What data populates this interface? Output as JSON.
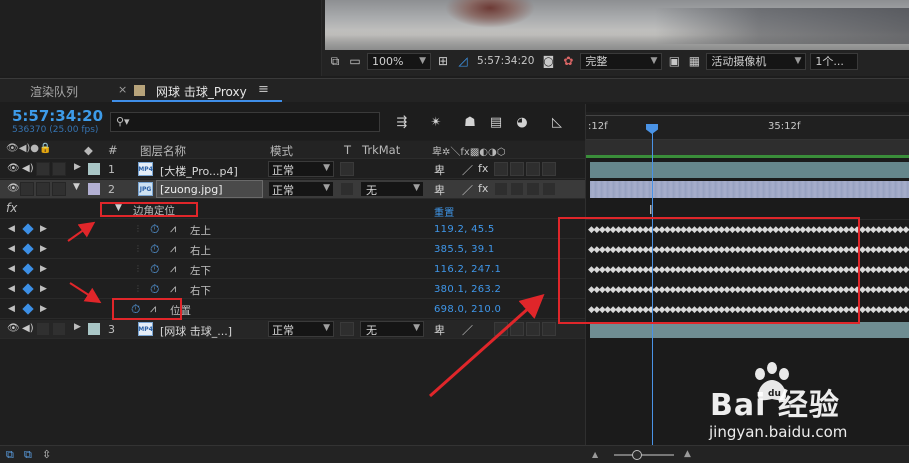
{
  "viewer_toolbar": {
    "zoom": "100%",
    "timecode": "5:57:34:20",
    "resolution": "完整",
    "camera": "活动摄像机",
    "views": "1个..."
  },
  "panel_tabs": {
    "render_queue": "渲染队列",
    "close_glyph": "×",
    "comp_name": "网球 击球_Proxy",
    "menu_glyph": "≡"
  },
  "timeline": {
    "current_time": "5:57:34:20",
    "frame_info": "536370 (25.00 fps)",
    "search_placeholder": "",
    "ruler_labels": [
      ":12f",
      "35:12f"
    ]
  },
  "columns": {
    "number": "#",
    "layer_name": "图层名称",
    "mode": "模式",
    "t": "T",
    "trkmat": "TrkMat"
  },
  "layers": [
    {
      "number": "1",
      "name": "[大楼_Pro...p4]",
      "mode": "正常",
      "trkmat": "",
      "label_color": "#a9c6c6",
      "file_type": "MP4"
    },
    {
      "number": "2",
      "name": "[zuong.jpg]",
      "mode": "正常",
      "trkmat": "无",
      "label_color": "#b3b0d3",
      "file_type": "JPG"
    },
    {
      "number": "3",
      "name": "[网球 击球_...]",
      "mode": "正常",
      "trkmat": "无",
      "label_color": "#a9c6c6",
      "file_type": "MP4"
    }
  ],
  "effect": {
    "fx_glyph": "fx",
    "name": "边角定位",
    "reset": "重置"
  },
  "properties": [
    {
      "name": "左上",
      "value": "119.2, 45.5"
    },
    {
      "name": "右上",
      "value": "385.5, 39.1"
    },
    {
      "name": "左下",
      "value": "116.2, 247.1"
    },
    {
      "name": "右下",
      "value": "380.1, 263.2"
    },
    {
      "name": "位置",
      "value": "698.0, 210.0"
    }
  ],
  "keyframe_strip": "◆◆◆◆◆◆◆◆◆◆◆◆◆◆◆◆◆◆◆◆◆◆◆◆◆◆◆◆◆◆◆◆◆◆◆◆◆◆◆◆◆◆◆◆◆◆◆◆◆◆◆◆◆◆◆◆◆◆◆◆◆◆◆◆◆◆◆◆◆◆◆◆◆◆◆◆◆◆◆◆◆◆◆◆◆◆◆◆◆◆◆◆◆◆◆◆◆◆◆◆◆◆◆◆◆◆◆◆◆◆◆◆◆◆◆◆",
  "watermark": {
    "brand": "Bai 经验",
    "url": "jingyan.baidu.com"
  },
  "colors": {
    "accent_blue": "#3f97ea",
    "annotation_red": "#e0262a",
    "work_area_green": "#3a8e3a"
  }
}
